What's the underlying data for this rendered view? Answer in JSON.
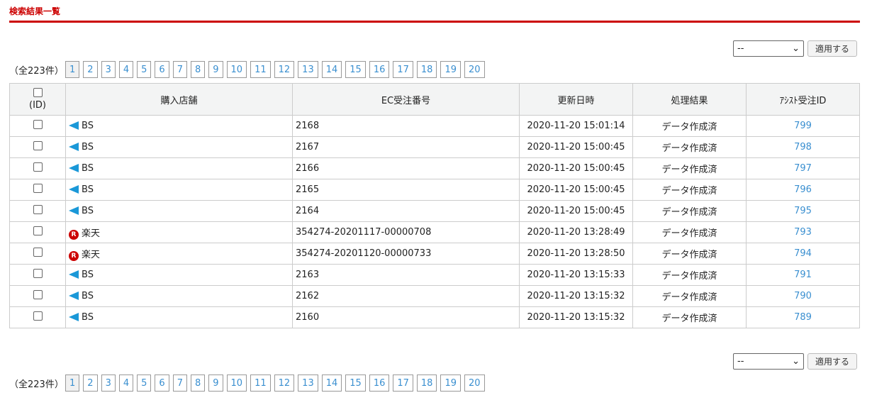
{
  "title": "検索結果一覧",
  "total": "（全223件）",
  "pages": [
    "1",
    "2",
    "3",
    "4",
    "5",
    "6",
    "7",
    "8",
    "9",
    "10",
    "11",
    "12",
    "13",
    "14",
    "15",
    "16",
    "17",
    "18",
    "19",
    "20"
  ],
  "current_page": "1",
  "action": {
    "select_value": "--",
    "apply_label": "適用する"
  },
  "headers": {
    "id": "(ID)",
    "store": "購入店舗",
    "ec_order": "EC受注番号",
    "updated": "更新日時",
    "result": "処理結果",
    "assist_id": "ｱｼｽﾄ受注ID"
  },
  "rows": [
    {
      "store": "BS",
      "icon": "bs-flag-icon",
      "ec": "2168",
      "updated": "2020-11-20 15:01:14",
      "result": "データ作成済",
      "aid": "799"
    },
    {
      "store": "BS",
      "icon": "bs-flag-icon",
      "ec": "2167",
      "updated": "2020-11-20 15:00:45",
      "result": "データ作成済",
      "aid": "798"
    },
    {
      "store": "BS",
      "icon": "bs-flag-icon",
      "ec": "2166",
      "updated": "2020-11-20 15:00:45",
      "result": "データ作成済",
      "aid": "797"
    },
    {
      "store": "BS",
      "icon": "bs-flag-icon",
      "ec": "2165",
      "updated": "2020-11-20 15:00:45",
      "result": "データ作成済",
      "aid": "796"
    },
    {
      "store": "BS",
      "icon": "bs-flag-icon",
      "ec": "2164",
      "updated": "2020-11-20 15:00:45",
      "result": "データ作成済",
      "aid": "795"
    },
    {
      "store": "楽天",
      "icon": "rakuten-icon",
      "ec": "354274-20201117-00000708",
      "updated": "2020-11-20 13:28:49",
      "result": "データ作成済",
      "aid": "793"
    },
    {
      "store": "楽天",
      "icon": "rakuten-icon",
      "ec": "354274-20201120-00000733",
      "updated": "2020-11-20 13:28:50",
      "result": "データ作成済",
      "aid": "794"
    },
    {
      "store": "BS",
      "icon": "bs-flag-icon",
      "ec": "2163",
      "updated": "2020-11-20 13:15:33",
      "result": "データ作成済",
      "aid": "791"
    },
    {
      "store": "BS",
      "icon": "bs-flag-icon",
      "ec": "2162",
      "updated": "2020-11-20 13:15:32",
      "result": "データ作成済",
      "aid": "790"
    },
    {
      "store": "BS",
      "icon": "bs-flag-icon",
      "ec": "2160",
      "updated": "2020-11-20 13:15:32",
      "result": "データ作成済",
      "aid": "789"
    }
  ]
}
